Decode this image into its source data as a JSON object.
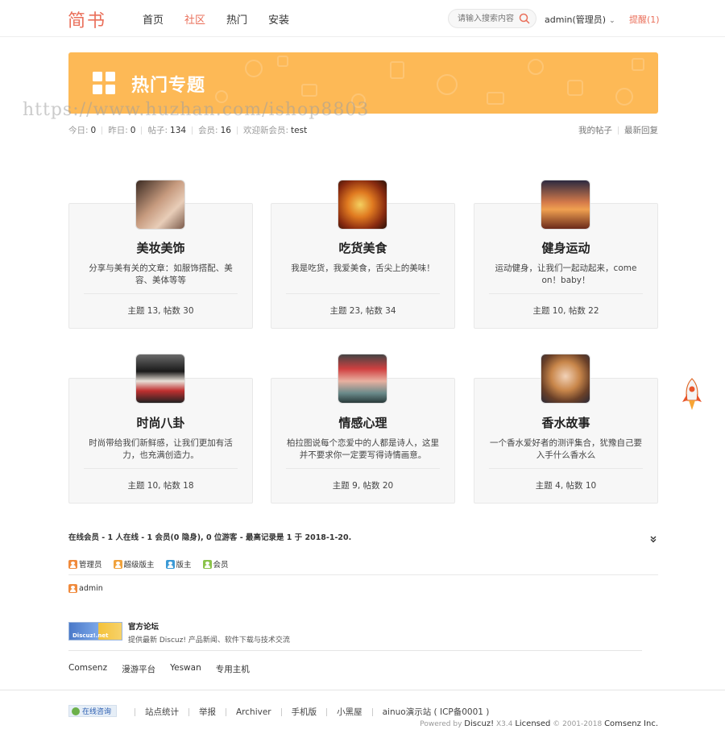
{
  "header": {
    "logo": "简书",
    "nav": [
      {
        "label": "首页",
        "active": false
      },
      {
        "label": "社区",
        "active": true
      },
      {
        "label": "热门",
        "active": false
      },
      {
        "label": "安装",
        "active": false
      }
    ],
    "search_placeholder": "请输入搜索内容",
    "user": "admin(管理员)",
    "remind": "提醒(1)"
  },
  "banner": {
    "title": "热门专题",
    "color": "#fdb956"
  },
  "watermark": "https://www.huzhan.com/ishop8803",
  "stats": [
    {
      "label": "今日:",
      "value": "0"
    },
    {
      "label": "昨日:",
      "value": "0"
    },
    {
      "label": "帖子:",
      "value": "134"
    },
    {
      "label": "会员:",
      "value": "16"
    },
    {
      "label": "欢迎新会员:",
      "value": "test"
    }
  ],
  "quick_links": [
    "我的帖子",
    "最新回复"
  ],
  "topics": [
    {
      "title": "美妆美饰",
      "desc": "分享与美有关的文章：如服饰搭配、美容、美体等等",
      "meta": "主题 13, 帖数 30",
      "avatar": "makeup-photo"
    },
    {
      "title": "吃货美食",
      "desc": "我是吃货，我爱美食，舌尖上的美味！",
      "meta": "主题 23, 帖数 34",
      "avatar": "food-photo"
    },
    {
      "title": "健身运动",
      "desc": "运动健身，让我们一起动起来，come on！baby！",
      "meta": "主题 10, 帖数 22",
      "avatar": "running-photo"
    },
    {
      "title": "时尚八卦",
      "desc": "时尚带给我们新鲜感，让我们更加有活力，也充满创造力。",
      "meta": "主题 10, 帖数 18",
      "avatar": "fashion-photo"
    },
    {
      "title": "情感心理",
      "desc": "柏拉图说每个恋爱中的人都是诗人，这里并不要求你一定要写得诗情画意。",
      "meta": "主题 9, 帖数 20",
      "avatar": "couple-illustration"
    },
    {
      "title": "香水故事",
      "desc": "一个香水爱好者的测评集合，犹豫自己要入手什么香水么",
      "meta": "主题 4, 帖数 10",
      "avatar": "girl-photo"
    }
  ],
  "online": {
    "summary": "在线会员 - 1 人在线 - 1 会员(0 隐身), 0 位游客 - 最高记录是 1 于 2018-1-20.",
    "legend": [
      {
        "label": "管理员",
        "color": "#f08a3c"
      },
      {
        "label": "超级版主",
        "color": "#f0a23c"
      },
      {
        "label": "版主",
        "color": "#3c9ad6"
      },
      {
        "label": "会员",
        "color": "#8bc34a"
      }
    ],
    "members": [
      "admin"
    ]
  },
  "official": {
    "logo_text": "Discuz!.net",
    "name": "官方论坛",
    "desc": "提供最新 Discuz! 产品新闻、软件下载与技术交流"
  },
  "friend_links": [
    "Comsenz",
    "漫游平台",
    "Yeswan",
    "专用主机"
  ],
  "footer": {
    "consult": "在线咨询",
    "links": [
      "站点统计",
      "举报",
      "Archiver",
      "手机版",
      "小黑屋",
      "ainuo演示站 ( ICP备0001 )"
    ],
    "powered_prefix": "Powered by",
    "powered_brand": "Discuz!",
    "powered_version": "X3.4",
    "licensed": "Licensed",
    "copyright": "© 2001-2018",
    "company": "Comsenz Inc."
  }
}
